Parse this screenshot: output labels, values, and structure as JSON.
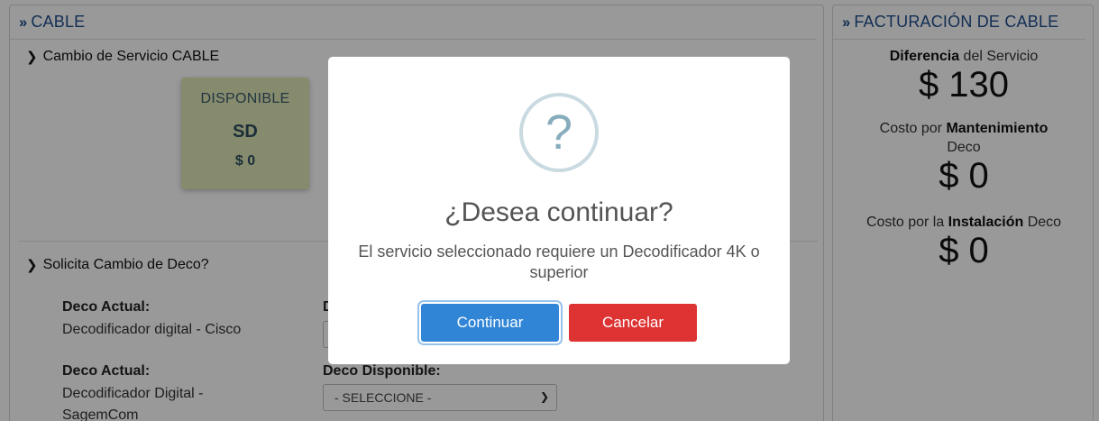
{
  "left_panel": {
    "title": "CABLE",
    "section1_title": "Cambio de Servicio CABLE",
    "plan_card": {
      "status": "DISPONIBLE",
      "name": "SD",
      "price": "$ 0"
    },
    "section2_title": "Solicita Cambio de Deco?",
    "deco_rows": [
      {
        "label": "Deco Actual:",
        "value": "Decodificador digital - Cisco",
        "right_label": "D"
      },
      {
        "label": "Deco Actual:",
        "value": "Decodificador Digital - SagemCom",
        "right_label": "Deco Disponible:"
      }
    ],
    "select_placeholder": "- SELECCIONE -"
  },
  "right_panel": {
    "title": "FACTURACIÓN DE CABLE",
    "diff_label_bold": "Diferencia",
    "diff_label_rest": " del Servicio",
    "diff_amount": "$ 130",
    "mant_label_pre": "Costo por ",
    "mant_label_bold": "Mantenimiento",
    "mant_label_line2": "Deco",
    "mant_amount": "$ 0",
    "inst_label_pre": "Costo por la ",
    "inst_label_bold": "Instalación",
    "inst_label_rest": " Deco",
    "inst_amount": "$ 0"
  },
  "modal": {
    "icon_glyph": "?",
    "title": "¿Desea continuar?",
    "text": "El servicio seleccionado requiere un Decodificador 4K o superior",
    "confirm_label": "Continuar",
    "cancel_label": "Cancelar"
  },
  "colors": {
    "header_blue": "#1f4e8c",
    "card_bg": "#dfe8b8",
    "confirm_blue": "#3085d6",
    "cancel_red": "#dd3333"
  }
}
